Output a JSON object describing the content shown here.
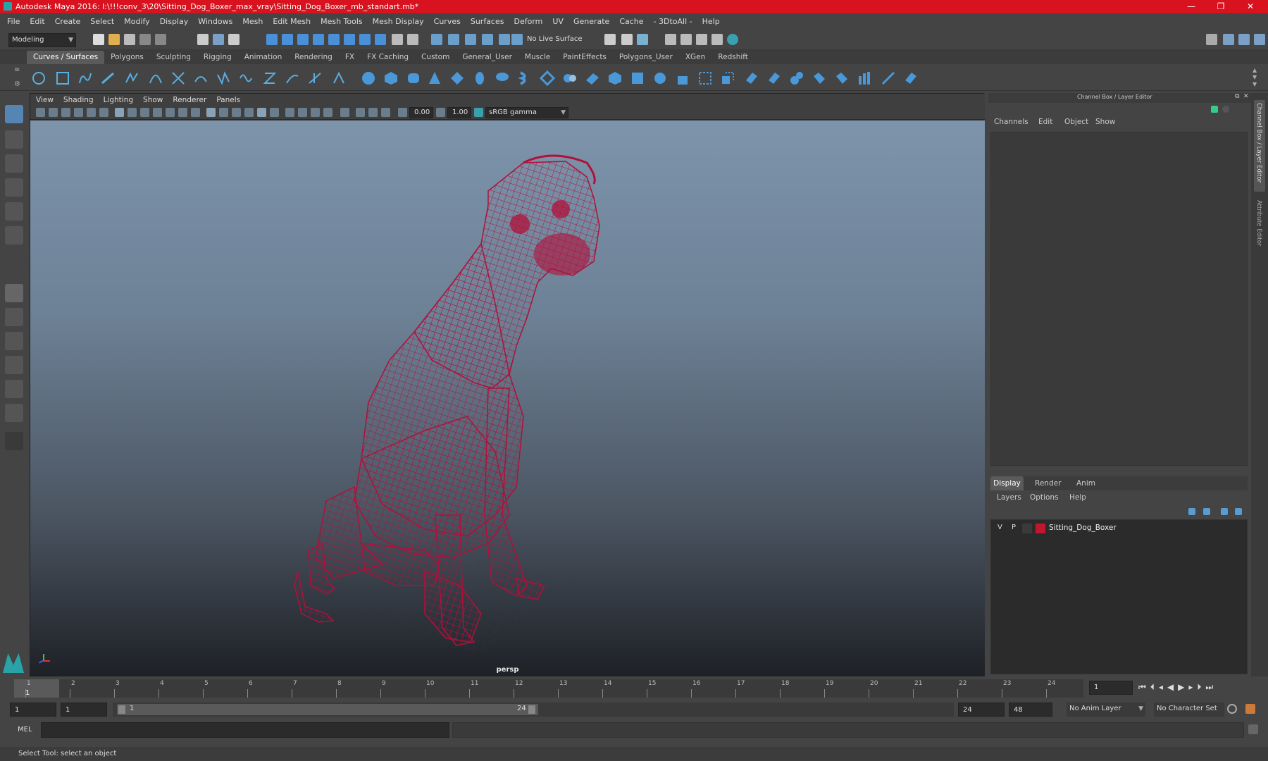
{
  "window": {
    "title": "Autodesk Maya 2016: I:\\!!!conv_3\\20\\Sitting_Dog_Boxer_max_vray\\Sitting_Dog_Boxer_mb_standart.mb*"
  },
  "menubar": [
    "File",
    "Edit",
    "Create",
    "Select",
    "Modify",
    "Display",
    "Windows",
    "Mesh",
    "Edit Mesh",
    "Mesh Tools",
    "Mesh Display",
    "Curves",
    "Surfaces",
    "Deform",
    "UV",
    "Generate",
    "Cache",
    "- 3DtoAll -",
    "Help"
  ],
  "status": {
    "mode": "Modeling",
    "live_surface": "No Live Surface"
  },
  "shelf": {
    "tabs": [
      "Curves / Surfaces",
      "Polygons",
      "Sculpting",
      "Rigging",
      "Animation",
      "Rendering",
      "FX",
      "FX Caching",
      "Custom",
      "General_User",
      "Muscle",
      "PaintEffects",
      "Polygons_User",
      "XGen",
      "Redshift"
    ],
    "active": "Curves / Surfaces"
  },
  "viewport": {
    "menu": [
      "View",
      "Shading",
      "Lighting",
      "Show",
      "Renderer",
      "Panels"
    ],
    "exposure": "0.00",
    "gamma": "1.00",
    "colorspace": "sRGB gamma",
    "camera": "persp",
    "wire_color": "#b0103a"
  },
  "channel_box": {
    "title": "Channel Box / Layer Editor",
    "menu": [
      "Channels",
      "Edit",
      "Object",
      "Show"
    ],
    "tabs": [
      "Display",
      "Render",
      "Anim"
    ],
    "layer_menu": [
      "Layers",
      "Options",
      "Help"
    ],
    "layer": {
      "v": "V",
      "p": "P",
      "name": "Sitting_Dog_Boxer",
      "color": "#c0172f"
    }
  },
  "side_tabs": [
    "Channel Box / Layer Editor",
    "Attribute Editor"
  ],
  "timeline": {
    "ticks": [
      "1",
      "2",
      "3",
      "4",
      "5",
      "6",
      "7",
      "8",
      "9",
      "10",
      "11",
      "12",
      "13",
      "14",
      "15",
      "16",
      "17",
      "18",
      "19",
      "20",
      "21",
      "22",
      "23",
      "24"
    ],
    "current_frame_label": "1",
    "current_frame_field": "1"
  },
  "range": {
    "start": "1",
    "inner_start": "1",
    "slider_start": "1",
    "slider_end": "24",
    "end": "24",
    "max": "48",
    "anim_layer": "No Anim Layer",
    "char_set": "No Character Set"
  },
  "cmdline": {
    "label": "MEL"
  },
  "helpline": "Select Tool: select an object"
}
